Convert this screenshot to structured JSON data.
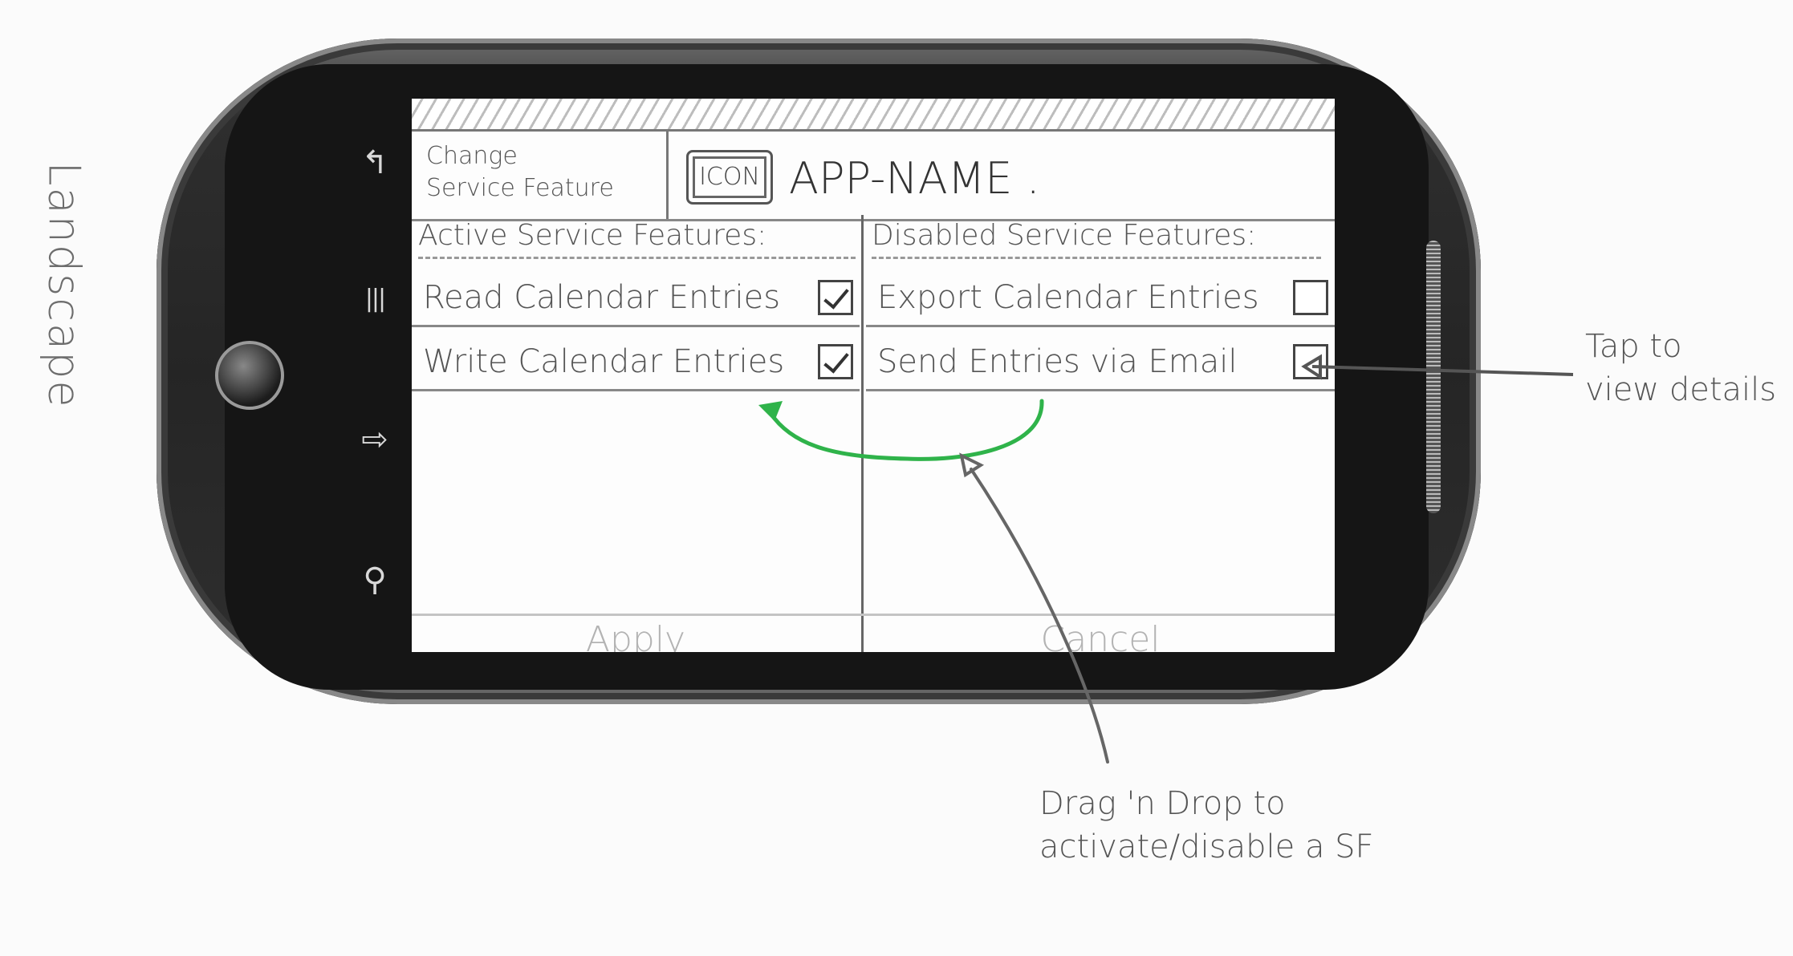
{
  "orientation_note": "Landscape",
  "device": {
    "nav_keys": [
      {
        "name": "back-key",
        "icon": "back-arrow-icon",
        "glyph": "↰"
      },
      {
        "name": "menu-key",
        "icon": "menu-icon",
        "glyph": "|||"
      },
      {
        "name": "home-key",
        "icon": "home-icon",
        "glyph": "⇨"
      },
      {
        "name": "search-key",
        "icon": "search-icon",
        "glyph": "⚲"
      }
    ]
  },
  "header": {
    "menu_label_line1": "Change",
    "menu_label_line2": "Service Feature",
    "icon_label": "ICON",
    "app_name": "APP-NAME ."
  },
  "active_column": {
    "title": "Active Service Features:",
    "items": [
      {
        "label": "Read Calendar Entries",
        "checked": true
      },
      {
        "label": "Write Calendar Entries",
        "checked": true
      }
    ]
  },
  "disabled_column": {
    "title": "Disabled Service Features:",
    "items": [
      {
        "label": "Export Calendar Entries",
        "checked": false
      },
      {
        "label": "Send Entries via Email",
        "checked": false
      }
    ]
  },
  "footer": {
    "apply_label": "Apply",
    "cancel_label": "Cancel"
  },
  "annotations": {
    "tap_note_line1": "Tap to",
    "tap_note_line2": "view details",
    "drag_note_line1": "Drag 'n Drop to",
    "drag_note_line2": "activate/disable a SF"
  },
  "colors": {
    "drag_arrow": "#2fb34a",
    "annotation_line": "#555555"
  }
}
